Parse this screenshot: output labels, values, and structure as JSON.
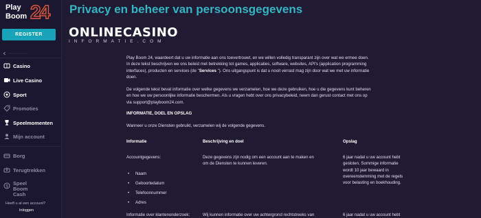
{
  "sidebar": {
    "logo": {
      "line1": "Play",
      "line2": "Boom",
      "number": "24"
    },
    "register_label": "REGISTER",
    "items": [
      {
        "label": "Casino",
        "icon": "casino-icon"
      },
      {
        "label": "Live Casino",
        "icon": "live-casino-icon"
      },
      {
        "label": "Sport",
        "icon": "sport-icon"
      },
      {
        "label": "Promoties",
        "icon": "promotions-icon"
      },
      {
        "label": "Speelmomenten",
        "icon": "trophy-icon"
      },
      {
        "label": "Mijn account",
        "icon": "account-icon"
      },
      {
        "label": "Borg",
        "icon": "deposit-icon"
      },
      {
        "label": "Terugtrekken",
        "icon": "withdraw-icon"
      },
      {
        "label": "Speel Boom Cash",
        "icon": "boom-cash-icon"
      }
    ],
    "footer_question": "Heeft u al een account?",
    "footer_login": "Inloggen"
  },
  "main": {
    "title": "Privacy en beheer van persoonsgegevens",
    "watermark": {
      "big": "ONLINECASINO",
      "small": "INFORMATIE.COM"
    },
    "paragraph1_lines": [
      "Play Boom 24, waardeert dat u uw informatie aan ons toevertrouwt, en we willen volledig transparant zijn over wat we ermee doen.",
      "In deze tekst beschrijven we ons beleid met betrekking tot games, applicaties, software, websites, API's (application programming",
      "interfaces), producten en services (de \"",
      "Services",
      " \"). Ons uitgangspunt is dat u nooit verrast mag zijn door wat we met uw informatie",
      "doen."
    ],
    "paragraph2_lines": [
      "De volgende tekst bevat informatie over welke gegevens we verzamelen, hoe we deze gebruiken, hoe u die gegevens kunt beheren",
      "en hoe we uw persoonlijke informatie beschermen. Als u vragen hebt over ons privacybeleid, neem dan gerust contact met ons op",
      "via support@playboom24.com."
    ],
    "section_heading": "INFORMATIE, DOEL EN OPSLAG",
    "intro": "Wanneer u onze Diensten gebruikt, verzamelen wij de volgende gegevens.",
    "table": {
      "headers": [
        "Informatie",
        "Beschrijving en doel",
        "Opslag"
      ],
      "row1": {
        "info": "Accountgegevens:",
        "desc_lines": [
          "Deze gegevens zijn nodig om een account aan te maken en",
          "om de Diensten te kunnen leveren."
        ],
        "storage_lines": [
          "6 jaar nadat u uw account hebt",
          "gesloten. Sommige informatie",
          "wordt 10 jaar bewaard in",
          "overeenstemming met de regels",
          "voor belasting en boekhouding."
        ]
      },
      "bullets": [
        "Naam",
        "Geboortedatum",
        "Telefoonnummer",
        "Adres"
      ],
      "row2": {
        "info": "Informatie over klantenonderzoek:",
        "desc": "Wij kunnen informatie over uw achtergrond rechtstreeks van",
        "storage": "6 jaar nadat u uw account hebt"
      }
    }
  },
  "colors": {
    "accent": "#18a4b8",
    "title": "#35b4c4",
    "brand": "#e0573b",
    "background": "#201a33"
  }
}
